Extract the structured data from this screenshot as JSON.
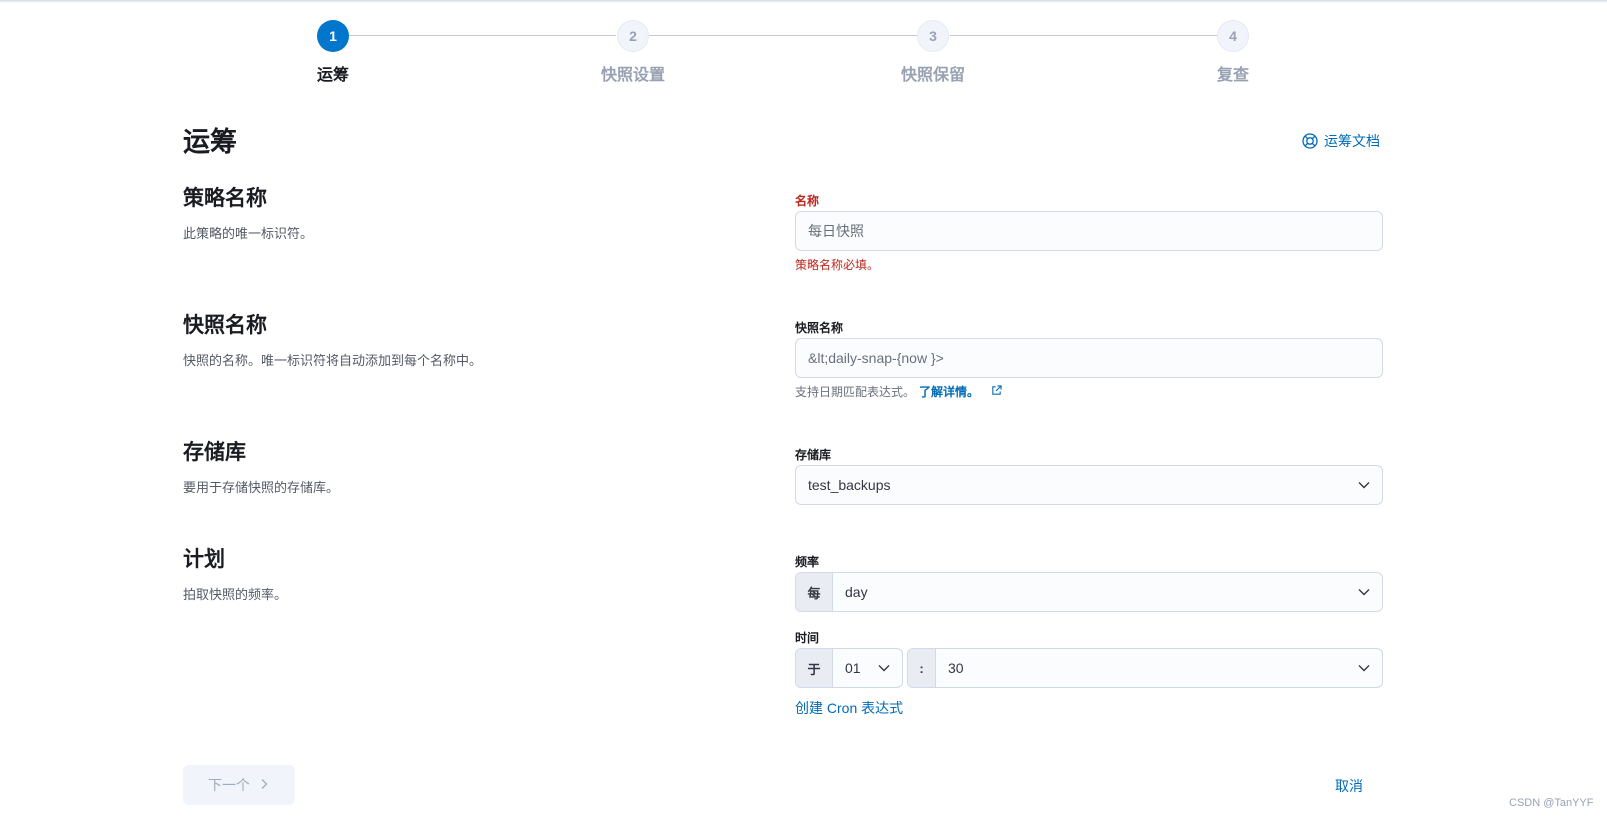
{
  "stepper": {
    "steps": [
      {
        "number": "1",
        "label": "运筹",
        "state": "active"
      },
      {
        "number": "2",
        "label": "快照设置",
        "state": "inactive"
      },
      {
        "number": "3",
        "label": "快照保留",
        "state": "inactive"
      },
      {
        "number": "4",
        "label": "复查",
        "state": "inactive"
      }
    ]
  },
  "page": {
    "title": "运筹",
    "docs_link": "运筹文档"
  },
  "sections": {
    "policy_name": {
      "title": "策略名称",
      "description": "此策略的唯一标识符。",
      "label": "名称",
      "placeholder": "每日快照",
      "value": "",
      "error": "策略名称必填。"
    },
    "snapshot_name": {
      "title": "快照名称",
      "description": "快照的名称。唯一标识符将自动添加到每个名称中。",
      "label": "快照名称",
      "placeholder": "&lt;daily-snap-{now }>",
      "value": "",
      "help_text": "支持日期匹配表达式。",
      "help_link": "了解详情。"
    },
    "repository": {
      "title": "存储库",
      "description": "要用于存储快照的存储库。",
      "label": "存储库",
      "value": "test_backups"
    },
    "schedule": {
      "title": "计划",
      "description": "拍取快照的频率。",
      "frequency_label": "频率",
      "frequency_prepend": "每",
      "frequency_value": "day",
      "time_label": "时间",
      "hour_prepend": "于",
      "hour_value": "01",
      "minute_prepend": ":",
      "minute_value": "30",
      "cron_link": "创建 Cron 表达式"
    }
  },
  "footer": {
    "next_label": "下一个",
    "cancel_label": "取消"
  },
  "watermark": "CSDN @TanYYF",
  "colors": {
    "primary": "#0077cc",
    "link": "#006bb8",
    "danger": "#bd271e"
  }
}
